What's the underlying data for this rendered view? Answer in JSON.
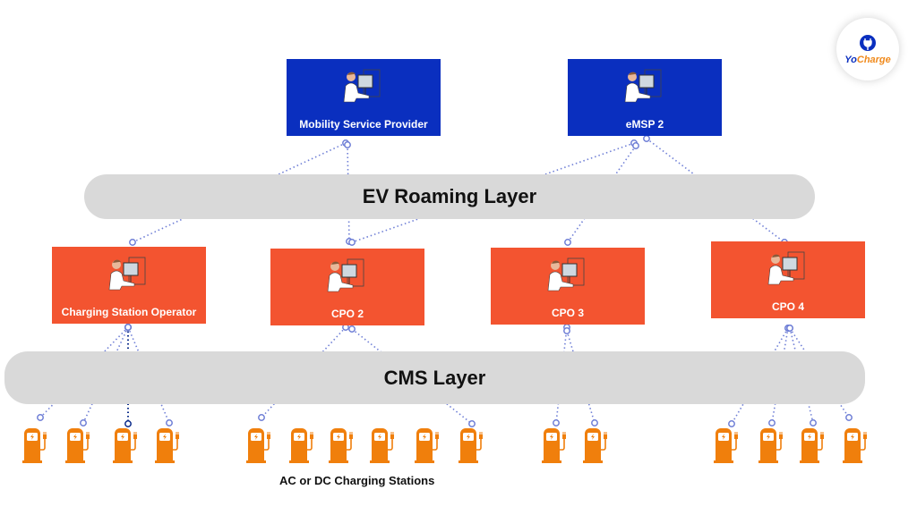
{
  "logo": {
    "brand": "YoCharge",
    "prefix": "Yo",
    "suffix": "Charge",
    "colors": {
      "prefix": "#0a2fbf",
      "suffix": "#f08a1c"
    }
  },
  "providers": [
    {
      "label": "Mobility Service Provider"
    },
    {
      "label": "eMSP 2"
    }
  ],
  "layers": {
    "roaming": "EV Roaming Layer",
    "cms": "CMS Layer"
  },
  "operators": [
    {
      "label": "Charging Station Operator"
    },
    {
      "label": "CPO 2"
    },
    {
      "label": "CPO 3"
    },
    {
      "label": "CPO 4"
    }
  ],
  "stations": {
    "caption": "AC or DC Charging Stations",
    "groups": [
      4,
      6,
      2,
      4
    ]
  },
  "colors": {
    "provider": "#0a2fbf",
    "operator": "#f35430",
    "layer": "#d9d9d9",
    "charger": "#f07f0c",
    "connector": "#6f7fd6"
  },
  "icons": {
    "person": "person-at-computer-icon",
    "charger": "ev-charger-icon"
  }
}
